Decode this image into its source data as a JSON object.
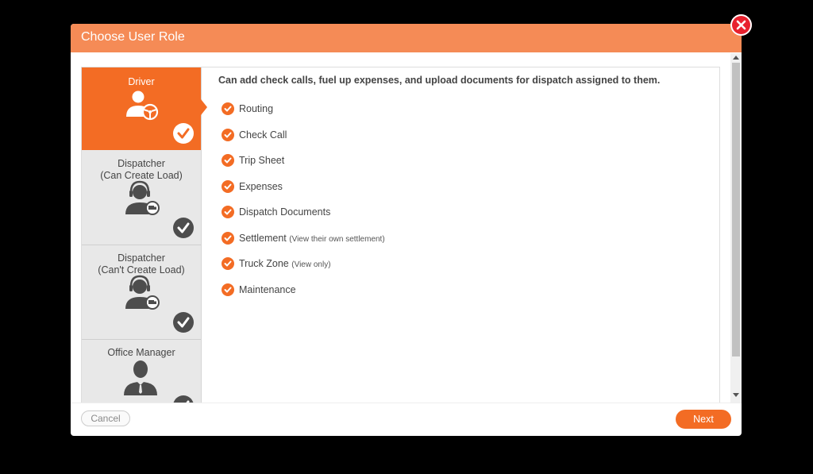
{
  "dialog": {
    "title": "Choose User Role",
    "close_icon": "close-icon",
    "accent_color": "#f36c24",
    "header_color": "#f58b56"
  },
  "roles": [
    {
      "label": "Driver",
      "selected": true,
      "icon": "driver-icon"
    },
    {
      "label": "Dispatcher\n(Can Create Load)",
      "selected": false,
      "icon": "dispatcher-headset-icon"
    },
    {
      "label": "Dispatcher\n(Can't Create Load)",
      "selected": false,
      "icon": "dispatcher-headset-icon"
    },
    {
      "label": "Office Manager",
      "selected": false,
      "icon": "office-manager-icon"
    }
  ],
  "role_description": "Can add check calls, fuel up expenses, and upload documents for dispatch assigned to them.",
  "permissions": [
    {
      "label": "Routing",
      "note": ""
    },
    {
      "label": "Check Call",
      "note": ""
    },
    {
      "label": "Trip Sheet",
      "note": ""
    },
    {
      "label": "Expenses",
      "note": ""
    },
    {
      "label": "Dispatch Documents",
      "note": ""
    },
    {
      "label": "Settlement",
      "note": "(View their own settlement)"
    },
    {
      "label": "Truck Zone",
      "note": "(View only)"
    },
    {
      "label": "Maintenance",
      "note": ""
    }
  ],
  "footer": {
    "cancel_label": "Cancel",
    "next_label": "Next"
  }
}
